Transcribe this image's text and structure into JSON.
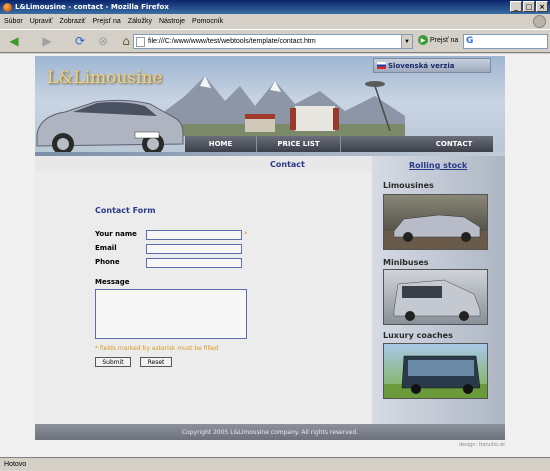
{
  "window": {
    "title": "L&Limousine - contact - Mozilla Firefox"
  },
  "menu": [
    "Súbor",
    "Upraviť",
    "Zobraziť",
    "Prejsť na",
    "Záložky",
    "Nástroje",
    "Pomocník"
  ],
  "toolbar": {
    "url": "file:///C:/www/www/test/webtools/template/contact.htm",
    "go_label": "Prejsť na"
  },
  "site": {
    "logo": "L&Limousine",
    "lang_label": "Slovenská verzia",
    "nav": [
      "HOME",
      "PRICE LIST",
      "CONTACT"
    ],
    "section_title": "Contact",
    "form": {
      "title": "Contact Form",
      "name_label": "Your name",
      "email_label": "Email",
      "phone_label": "Phone",
      "message_label": "Message",
      "required_mark": "*",
      "note": "* fields marked by asterisk must be filled",
      "submit_label": "Submit",
      "reset_label": "Reset"
    },
    "sidebar": {
      "link": "Rolling stock",
      "categories": [
        "Limousines",
        "Minibuses",
        "Luxury coaches"
      ]
    },
    "footer": "Copyright 2005 L&Limousine company. All rights reserved.",
    "credit": "design: ttstudio.sk"
  },
  "status": {
    "text": "Hotovo"
  }
}
